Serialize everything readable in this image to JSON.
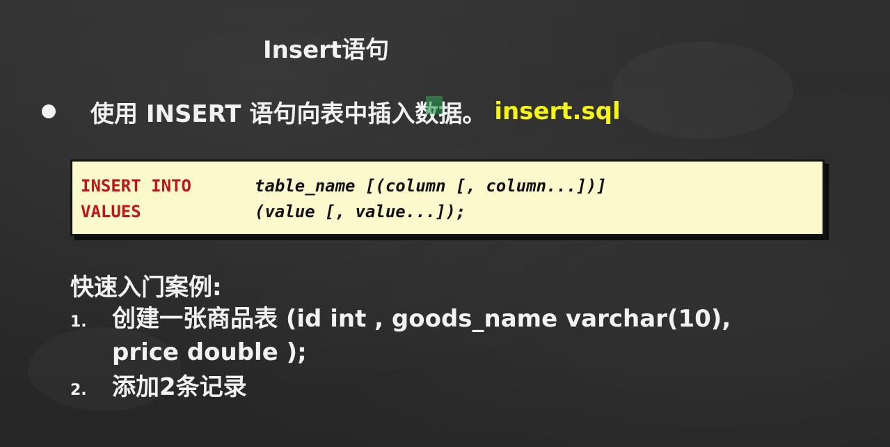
{
  "slide": {
    "title": "Insert语句",
    "bullet": {
      "text": "使用 INSERT 语句向表中插入数据。",
      "file": "insert.sql"
    },
    "code": {
      "line1": {
        "keyword": "INSERT INTO",
        "syntax": "table_name [(column [, column...])]"
      },
      "line2": {
        "keyword": "VALUES",
        "syntax": "(value [, value...]);"
      }
    },
    "quickstart": {
      "heading": "快速入门案例:",
      "steps": [
        {
          "num": "1.",
          "text": "创建一张商品表 (id  int , goods_name varchar(10),",
          "continuation": "price double );"
        },
        {
          "num": "2.",
          "text": "添加2条记录"
        }
      ]
    },
    "colors": {
      "background": "#2b2b2b",
      "text": "#f2f2f2",
      "highlight": "#f5f51a",
      "code_bg": "#fcf9cc",
      "keyword": "#c0141a"
    }
  }
}
